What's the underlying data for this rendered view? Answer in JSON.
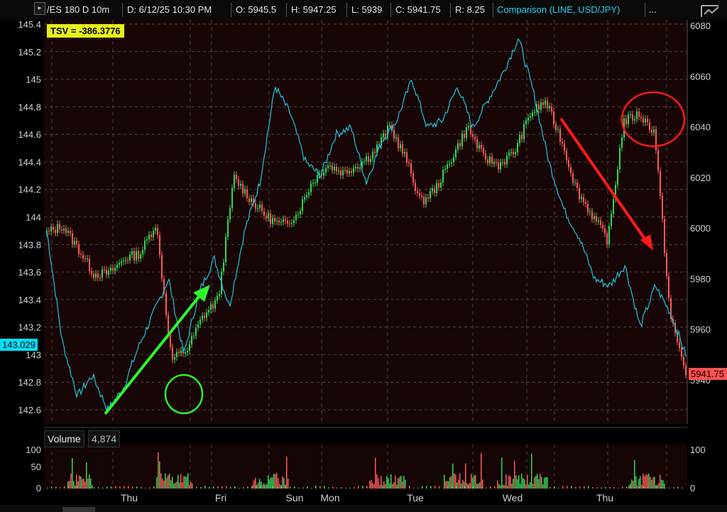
{
  "header": {
    "symbol": "/ES 180 D 10m",
    "datetime": "D: 6/12/25 10:30 PM",
    "open": "O: 5945.5",
    "high": "H: 5947.25",
    "low": "L: 5939",
    "close": "C: 5941.75",
    "range": "R: 8.25",
    "comparison": "Comparison (LINE, USD/JPY)",
    "more": "..."
  },
  "badges": {
    "tsv": "TSV  = -386.3776",
    "comparison_value": "143.029",
    "last_price": "5941.75"
  },
  "colors": {
    "comparison_line": "#1fb8d0",
    "up_candle": "#33d65a",
    "down_candle": "#ff5a5a",
    "bg": "#180606",
    "grid": "#5a5a5a",
    "green_annotation": "#2cf52c",
    "red_annotation": "#ff1a1a"
  },
  "volume": {
    "label": "Volume",
    "value": "4,874",
    "left_ticks": [
      "100",
      "50",
      "0"
    ],
    "right_ticks": [
      "100",
      "0"
    ]
  },
  "chart_data": {
    "type": "line",
    "title": "/ES 180 D 10m",
    "x_ticks": [
      "Thu",
      "Fri",
      "Sun",
      "Mon",
      "Tue",
      "Wed",
      "Thu"
    ],
    "left_axis_ticks": [
      "145.4",
      "145.2",
      "145",
      "144.8",
      "144.6",
      "144.4",
      "144.2",
      "144",
      "143.8",
      "143.6",
      "143.4",
      "143.2",
      "143",
      "142.8",
      "142.6"
    ],
    "right_axis_ticks": [
      "6080",
      "6060",
      "6040",
      "6020",
      "6000",
      "5980",
      "5960",
      "5940"
    ],
    "left_ylim": [
      142.5,
      145.4
    ],
    "right_ylim": [
      5936,
      6080
    ],
    "series": [
      {
        "name": "Comparison (LINE, USD/JPY)",
        "axis": "left",
        "values": [
          143.9,
          143.1,
          142.7,
          142.85,
          142.6,
          142.75,
          143.05,
          143.3,
          143.55,
          143.0,
          143.45,
          143.7,
          143.35,
          143.9,
          144.25,
          144.95,
          144.75,
          144.4,
          144.3,
          144.6,
          144.65,
          144.25,
          144.55,
          144.7,
          145.0,
          144.65,
          144.7,
          144.95,
          144.65,
          144.85,
          145.05,
          145.3,
          144.9,
          144.4,
          144.05,
          143.85,
          143.55,
          143.5,
          143.65,
          143.2,
          143.5,
          143.3,
          143.0
        ]
      },
      {
        "name": "/ES",
        "axis": "right",
        "values": [
          5998,
          6001,
          5992,
          5982,
          5982,
          5988,
          5990,
          6002,
          5948,
          5952,
          5965,
          5972,
          6020,
          6012,
          6005,
          6001,
          6005,
          6018,
          6025,
          6022,
          6025,
          6030,
          6040,
          6028,
          6010,
          6016,
          6028,
          6040,
          6028,
          6025,
          6030,
          6045,
          6050,
          6035,
          6015,
          6005,
          5995,
          6042,
          6045,
          6038,
          5965,
          5943
        ]
      }
    ],
    "annotations": [
      {
        "type": "arrow",
        "color": "green"
      },
      {
        "type": "arrow",
        "color": "red"
      },
      {
        "type": "circle",
        "color": "green"
      },
      {
        "type": "circle",
        "color": "red"
      }
    ]
  }
}
